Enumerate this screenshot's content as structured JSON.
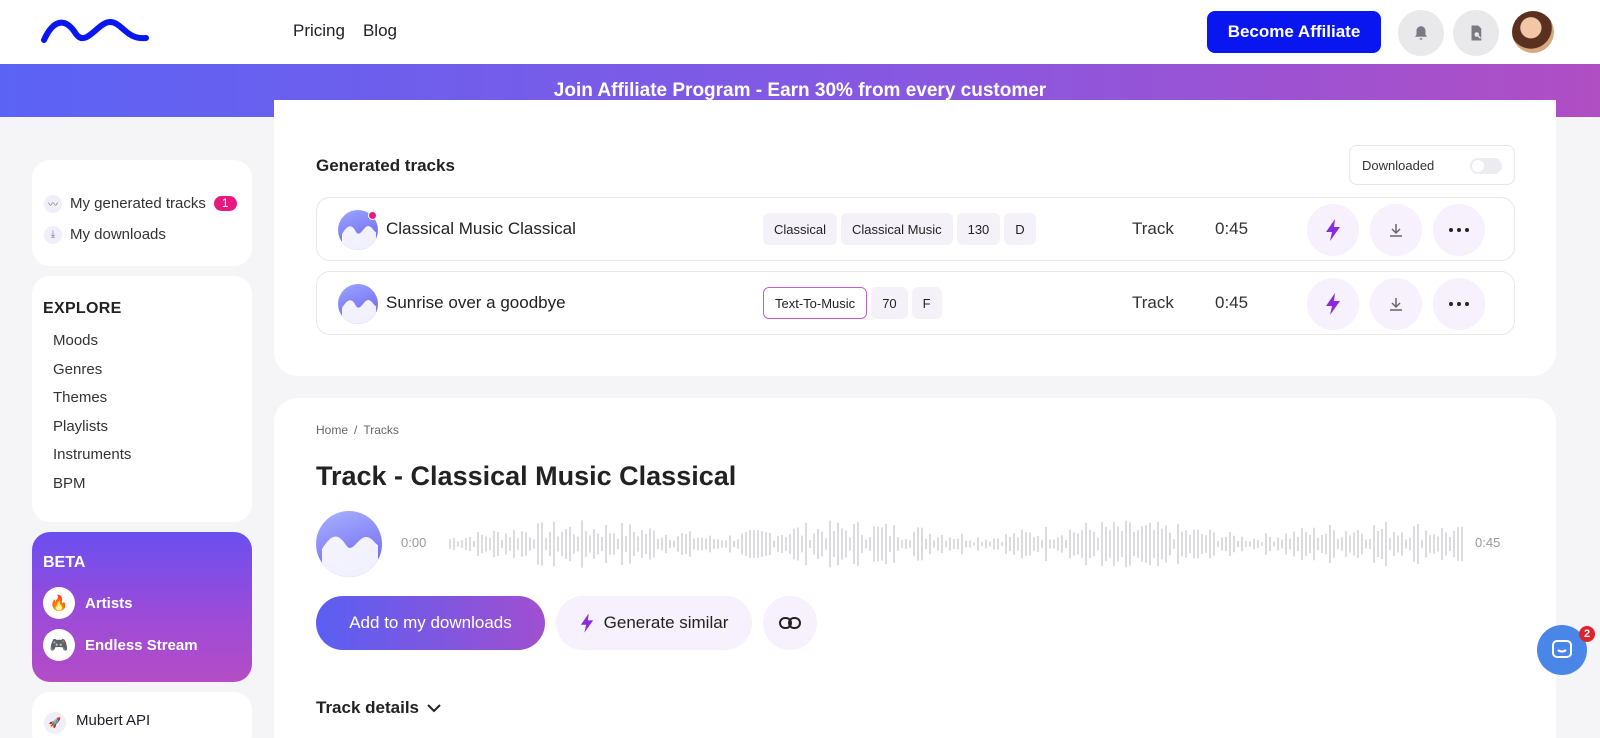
{
  "header": {
    "nav": [
      "Pricing",
      "Blog"
    ],
    "affiliate_button": "Become Affiliate"
  },
  "banner": {
    "text": "Join Affiliate Program - Earn 30% from every customer"
  },
  "sidebar": {
    "mine": [
      {
        "label": "My generated tracks",
        "badge": "1",
        "icon": "wave-icon"
      },
      {
        "label": "My downloads",
        "icon": "download-icon"
      }
    ],
    "explore_title": "EXPLORE",
    "explore_items": [
      "Moods",
      "Genres",
      "Themes",
      "Playlists",
      "Instruments",
      "BPM"
    ],
    "beta": {
      "title": "BETA",
      "items": [
        {
          "label": "Artists",
          "icon": "fire-icon"
        },
        {
          "label": "Endless Stream",
          "icon": "gamepad-icon"
        }
      ]
    },
    "api_label": "Mubert API"
  },
  "generated": {
    "title": "Generated tracks",
    "downloaded_label": "Downloaded",
    "tracks": [
      {
        "name": "Classical Music Classical",
        "tags": [
          "Classical",
          "Classical Music",
          "130",
          "D"
        ],
        "type": "Track",
        "duration": "0:45",
        "new": true
      },
      {
        "name": "Sunrise over a goodbye",
        "tags": [
          "Text-To-Music",
          "70",
          "F"
        ],
        "type": "Track",
        "duration": "0:45",
        "new": false
      }
    ]
  },
  "detail": {
    "breadcrumb": [
      "Home",
      "Tracks"
    ],
    "title": "Track - Classical Music Classical",
    "time_start": "0:00",
    "time_end": "0:45",
    "add_button": "Add to my downloads",
    "similar_button": "Generate similar",
    "details_label": "Track details"
  },
  "chat": {
    "badge": "2"
  },
  "colors": {
    "brand_blue": "#0a16f0",
    "accent_pink": "#e5197e",
    "lightning_purple": "#8a2be2"
  }
}
